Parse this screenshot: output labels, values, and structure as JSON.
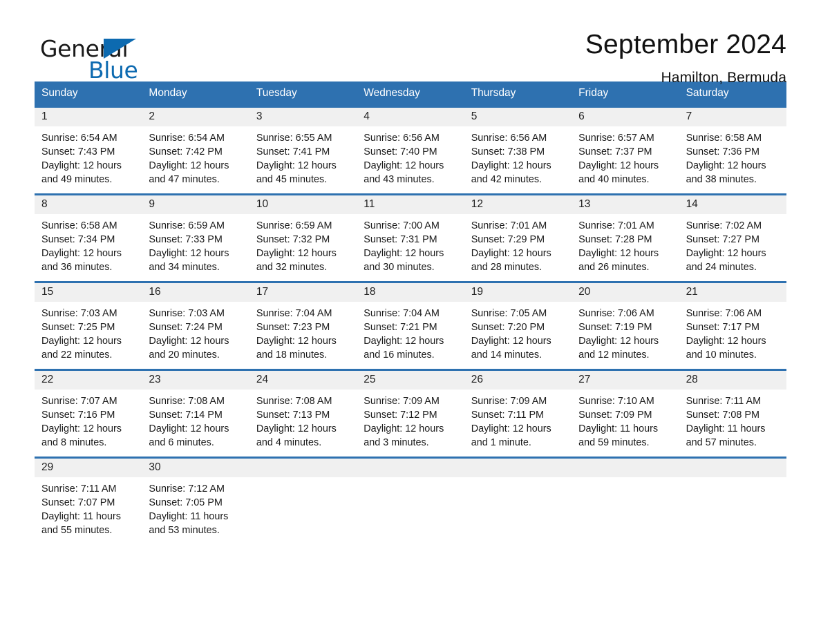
{
  "brand": {
    "name_part1": "General",
    "name_part2": "Blue",
    "accent_color": "#0d6ab0"
  },
  "header": {
    "title": "September 2024",
    "location": "Hamilton, Bermuda"
  },
  "theme": {
    "header_bg": "#2e71b0",
    "daynum_bg": "#f0f0f0",
    "separator": "#2e71b0"
  },
  "weekdays": [
    "Sunday",
    "Monday",
    "Tuesday",
    "Wednesday",
    "Thursday",
    "Friday",
    "Saturday"
  ],
  "weeks": [
    {
      "days": [
        {
          "num": "1",
          "sunrise": "Sunrise: 6:54 AM",
          "sunset": "Sunset: 7:43 PM",
          "daylight": "Daylight: 12 hours and 49 minutes."
        },
        {
          "num": "2",
          "sunrise": "Sunrise: 6:54 AM",
          "sunset": "Sunset: 7:42 PM",
          "daylight": "Daylight: 12 hours and 47 minutes."
        },
        {
          "num": "3",
          "sunrise": "Sunrise: 6:55 AM",
          "sunset": "Sunset: 7:41 PM",
          "daylight": "Daylight: 12 hours and 45 minutes."
        },
        {
          "num": "4",
          "sunrise": "Sunrise: 6:56 AM",
          "sunset": "Sunset: 7:40 PM",
          "daylight": "Daylight: 12 hours and 43 minutes."
        },
        {
          "num": "5",
          "sunrise": "Sunrise: 6:56 AM",
          "sunset": "Sunset: 7:38 PM",
          "daylight": "Daylight: 12 hours and 42 minutes."
        },
        {
          "num": "6",
          "sunrise": "Sunrise: 6:57 AM",
          "sunset": "Sunset: 7:37 PM",
          "daylight": "Daylight: 12 hours and 40 minutes."
        },
        {
          "num": "7",
          "sunrise": "Sunrise: 6:58 AM",
          "sunset": "Sunset: 7:36 PM",
          "daylight": "Daylight: 12 hours and 38 minutes."
        }
      ]
    },
    {
      "days": [
        {
          "num": "8",
          "sunrise": "Sunrise: 6:58 AM",
          "sunset": "Sunset: 7:34 PM",
          "daylight": "Daylight: 12 hours and 36 minutes."
        },
        {
          "num": "9",
          "sunrise": "Sunrise: 6:59 AM",
          "sunset": "Sunset: 7:33 PM",
          "daylight": "Daylight: 12 hours and 34 minutes."
        },
        {
          "num": "10",
          "sunrise": "Sunrise: 6:59 AM",
          "sunset": "Sunset: 7:32 PM",
          "daylight": "Daylight: 12 hours and 32 minutes."
        },
        {
          "num": "11",
          "sunrise": "Sunrise: 7:00 AM",
          "sunset": "Sunset: 7:31 PM",
          "daylight": "Daylight: 12 hours and 30 minutes."
        },
        {
          "num": "12",
          "sunrise": "Sunrise: 7:01 AM",
          "sunset": "Sunset: 7:29 PM",
          "daylight": "Daylight: 12 hours and 28 minutes."
        },
        {
          "num": "13",
          "sunrise": "Sunrise: 7:01 AM",
          "sunset": "Sunset: 7:28 PM",
          "daylight": "Daylight: 12 hours and 26 minutes."
        },
        {
          "num": "14",
          "sunrise": "Sunrise: 7:02 AM",
          "sunset": "Sunset: 7:27 PM",
          "daylight": "Daylight: 12 hours and 24 minutes."
        }
      ]
    },
    {
      "days": [
        {
          "num": "15",
          "sunrise": "Sunrise: 7:03 AM",
          "sunset": "Sunset: 7:25 PM",
          "daylight": "Daylight: 12 hours and 22 minutes."
        },
        {
          "num": "16",
          "sunrise": "Sunrise: 7:03 AM",
          "sunset": "Sunset: 7:24 PM",
          "daylight": "Daylight: 12 hours and 20 minutes."
        },
        {
          "num": "17",
          "sunrise": "Sunrise: 7:04 AM",
          "sunset": "Sunset: 7:23 PM",
          "daylight": "Daylight: 12 hours and 18 minutes."
        },
        {
          "num": "18",
          "sunrise": "Sunrise: 7:04 AM",
          "sunset": "Sunset: 7:21 PM",
          "daylight": "Daylight: 12 hours and 16 minutes."
        },
        {
          "num": "19",
          "sunrise": "Sunrise: 7:05 AM",
          "sunset": "Sunset: 7:20 PM",
          "daylight": "Daylight: 12 hours and 14 minutes."
        },
        {
          "num": "20",
          "sunrise": "Sunrise: 7:06 AM",
          "sunset": "Sunset: 7:19 PM",
          "daylight": "Daylight: 12 hours and 12 minutes."
        },
        {
          "num": "21",
          "sunrise": "Sunrise: 7:06 AM",
          "sunset": "Sunset: 7:17 PM",
          "daylight": "Daylight: 12 hours and 10 minutes."
        }
      ]
    },
    {
      "days": [
        {
          "num": "22",
          "sunrise": "Sunrise: 7:07 AM",
          "sunset": "Sunset: 7:16 PM",
          "daylight": "Daylight: 12 hours and 8 minutes."
        },
        {
          "num": "23",
          "sunrise": "Sunrise: 7:08 AM",
          "sunset": "Sunset: 7:14 PM",
          "daylight": "Daylight: 12 hours and 6 minutes."
        },
        {
          "num": "24",
          "sunrise": "Sunrise: 7:08 AM",
          "sunset": "Sunset: 7:13 PM",
          "daylight": "Daylight: 12 hours and 4 minutes."
        },
        {
          "num": "25",
          "sunrise": "Sunrise: 7:09 AM",
          "sunset": "Sunset: 7:12 PM",
          "daylight": "Daylight: 12 hours and 3 minutes."
        },
        {
          "num": "26",
          "sunrise": "Sunrise: 7:09 AM",
          "sunset": "Sunset: 7:11 PM",
          "daylight": "Daylight: 12 hours and 1 minute."
        },
        {
          "num": "27",
          "sunrise": "Sunrise: 7:10 AM",
          "sunset": "Sunset: 7:09 PM",
          "daylight": "Daylight: 11 hours and 59 minutes."
        },
        {
          "num": "28",
          "sunrise": "Sunrise: 7:11 AM",
          "sunset": "Sunset: 7:08 PM",
          "daylight": "Daylight: 11 hours and 57 minutes."
        }
      ]
    },
    {
      "days": [
        {
          "num": "29",
          "sunrise": "Sunrise: 7:11 AM",
          "sunset": "Sunset: 7:07 PM",
          "daylight": "Daylight: 11 hours and 55 minutes."
        },
        {
          "num": "30",
          "sunrise": "Sunrise: 7:12 AM",
          "sunset": "Sunset: 7:05 PM",
          "daylight": "Daylight: 11 hours and 53 minutes."
        },
        {
          "num": "",
          "sunrise": "",
          "sunset": "",
          "daylight": ""
        },
        {
          "num": "",
          "sunrise": "",
          "sunset": "",
          "daylight": ""
        },
        {
          "num": "",
          "sunrise": "",
          "sunset": "",
          "daylight": ""
        },
        {
          "num": "",
          "sunrise": "",
          "sunset": "",
          "daylight": ""
        },
        {
          "num": "",
          "sunrise": "",
          "sunset": "",
          "daylight": ""
        }
      ]
    }
  ]
}
